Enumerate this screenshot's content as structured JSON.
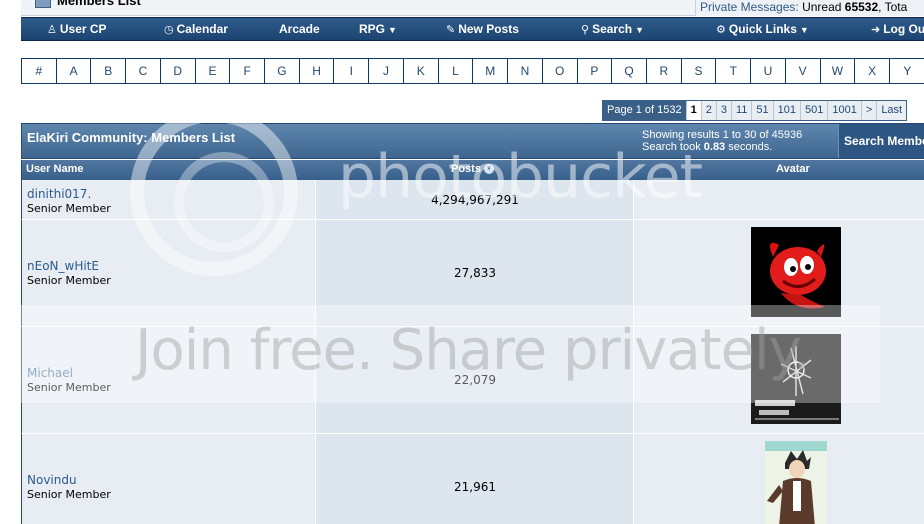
{
  "header": {
    "breadcrumb_title": "Members List",
    "private_messages_label": "Private Messages:",
    "unread_label": "Unread",
    "unread_count": "65532",
    "total_label": "Tota"
  },
  "navbar": {
    "items": [
      {
        "label": "User CP",
        "icon": "user-icon",
        "dropdown": false
      },
      {
        "label": "Calendar",
        "icon": "calendar-icon",
        "dropdown": false
      },
      {
        "label": "Arcade",
        "icon": "",
        "dropdown": false
      },
      {
        "label": "RPG",
        "icon": "",
        "dropdown": true
      },
      {
        "label": "New Posts",
        "icon": "new-posts-icon",
        "dropdown": false
      },
      {
        "label": "Search",
        "icon": "search-icon",
        "dropdown": true
      },
      {
        "label": "Quick Links",
        "icon": "quick-links-icon",
        "dropdown": true
      },
      {
        "label": "Log Ou",
        "icon": "log-out-icon",
        "dropdown": false
      }
    ]
  },
  "letters": [
    "#",
    "A",
    "B",
    "C",
    "D",
    "E",
    "F",
    "G",
    "H",
    "I",
    "J",
    "K",
    "L",
    "M",
    "N",
    "O",
    "P",
    "Q",
    "R",
    "S",
    "T",
    "U",
    "V",
    "W",
    "X",
    "Y"
  ],
  "pagination": {
    "label": "Page 1 of 1532",
    "pages": [
      "1",
      "2",
      "3",
      "11",
      "51",
      "101",
      "501",
      "1001",
      ">",
      "Last"
    ],
    "current": "1"
  },
  "members_table": {
    "title": "ElaKiri Community: Members List",
    "showing_prefix": "Showing results 1 to 30 of 45936",
    "search_took_prefix": "Search took",
    "search_time": "0.83",
    "search_took_suffix": "seconds.",
    "search_button": "Search Membe",
    "columns": {
      "username": "User Name",
      "posts": "Posts",
      "avatar": "Avatar"
    },
    "rows": [
      {
        "username": "dinithi017.",
        "title": "Senior Member",
        "posts": "4,294,967,291",
        "avatar": ""
      },
      {
        "username": "nEoN_wHitE",
        "title": "Senior Member",
        "posts": "27,833",
        "avatar": "red-devil-avatar"
      },
      {
        "username": "Michael",
        "title": "Senior Member",
        "posts": "22,079",
        "avatar": "linkin-park-avatar"
      },
      {
        "username": "Novindu",
        "title": "Senior Member",
        "posts": "21,961",
        "avatar": "anime-character-avatar"
      }
    ]
  },
  "watermark": {
    "brand": "photobucket",
    "tagline": "Join free. Share privately."
  },
  "colors": {
    "nav_bg": "#1c4472",
    "header_bg": "#3e6690",
    "row_light": "#e8edf3",
    "row_dark": "#dde5ee",
    "link": "#2a5a8c"
  }
}
